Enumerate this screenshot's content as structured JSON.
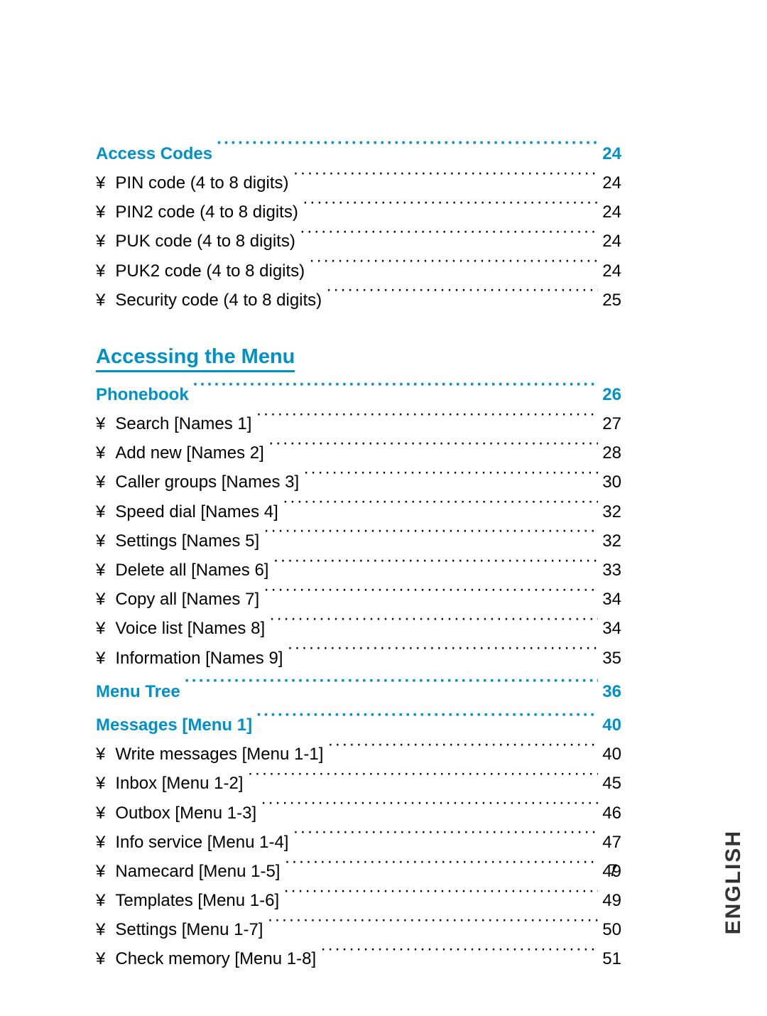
{
  "sections": [
    {
      "heading": {
        "label": "Access Codes",
        "page": "24"
      },
      "items": [
        {
          "label": "PIN code (4 to 8 digits)",
          "page": "24"
        },
        {
          "label": "PIN2 code (4 to 8 digits)",
          "page": "24"
        },
        {
          "label": "PUK code (4 to 8 digits)",
          "page": "24"
        },
        {
          "label": "PUK2 code (4 to 8 digits)",
          "page": "24"
        },
        {
          "label": "Security code (4 to 8 digits)",
          "page": "25"
        }
      ]
    }
  ],
  "chapter_title": "Accessing the Menu",
  "chapter_sections": [
    {
      "heading": {
        "label": "Phonebook",
        "page": "26"
      },
      "items": [
        {
          "label": "Search [Names 1]",
          "page": "27"
        },
        {
          "label": "Add new [Names 2]",
          "page": "28"
        },
        {
          "label": "Caller groups [Names 3]",
          "page": "30"
        },
        {
          "label": "Speed dial [Names 4]",
          "page": "32"
        },
        {
          "label": "Settings [Names 5]",
          "page": "32"
        },
        {
          "label": "Delete all [Names 6]",
          "page": "33"
        },
        {
          "label": "Copy all [Names 7]",
          "page": "34"
        },
        {
          "label": "Voice list [Names 8]",
          "page": "34"
        },
        {
          "label": "Information [Names 9]",
          "page": "35"
        }
      ]
    },
    {
      "heading": {
        "label": "Menu Tree",
        "page": "36"
      },
      "items": []
    },
    {
      "heading": {
        "label": "Messages [Menu 1]",
        "page": "40"
      },
      "items": [
        {
          "label": "Write messages [Menu 1-1]",
          "page": "40"
        },
        {
          "label": "Inbox [Menu 1-2]",
          "page": "45"
        },
        {
          "label": "Outbox [Menu 1-3]",
          "page": "46"
        },
        {
          "label": "Info service [Menu 1-4]",
          "page": "47"
        },
        {
          "label": "Namecard [Menu 1-5]",
          "page": "49"
        },
        {
          "label": "Templates [Menu 1-6]",
          "page": "49"
        },
        {
          "label": "Settings [Menu 1-7]",
          "page": "50"
        },
        {
          "label": "Check memory [Menu 1-8]",
          "page": "51"
        }
      ]
    }
  ],
  "bullet": "¥",
  "sidebar_text": "ENGLISH",
  "page_number": "7"
}
